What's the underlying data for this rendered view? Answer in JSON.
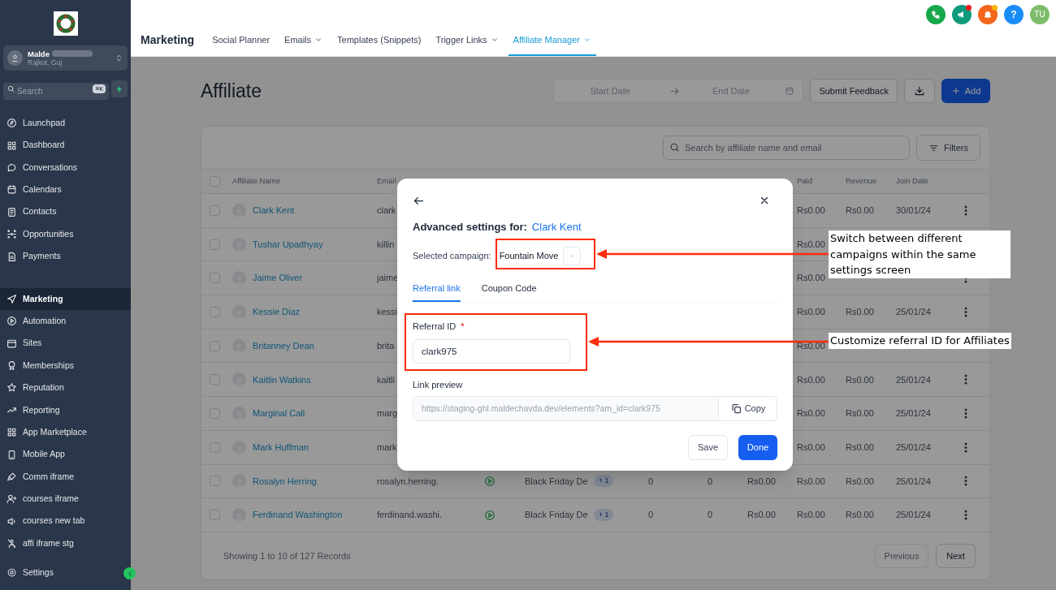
{
  "sidebar": {
    "account": {
      "name": "Malde",
      "location": "Rajkot, Guj"
    },
    "search": {
      "placeholder": "Search",
      "shortcut": "⌘K"
    },
    "groups": [
      {
        "items": [
          {
            "label": "Launchpad",
            "selected": false
          },
          {
            "label": "Dashboard",
            "selected": false
          },
          {
            "label": "Conversations",
            "selected": false
          },
          {
            "label": "Calendars",
            "selected": false
          },
          {
            "label": "Contacts",
            "selected": false
          },
          {
            "label": "Opportunities",
            "selected": false
          },
          {
            "label": "Payments",
            "selected": false
          }
        ]
      },
      {
        "items": [
          {
            "label": "Marketing",
            "selected": true
          },
          {
            "label": "Automation",
            "selected": false
          },
          {
            "label": "Sites",
            "selected": false
          },
          {
            "label": "Memberships",
            "selected": false
          },
          {
            "label": "Reputation",
            "selected": false
          },
          {
            "label": "Reporting",
            "selected": false
          },
          {
            "label": "App Marketplace",
            "selected": false
          },
          {
            "label": "Mobile App",
            "selected": false
          },
          {
            "label": "Comm iframe",
            "selected": false
          },
          {
            "label": "courses iframe",
            "selected": false
          },
          {
            "label": "courses new tab",
            "selected": false
          },
          {
            "label": "affi iframe stg",
            "selected": false
          }
        ]
      }
    ],
    "footer_item": {
      "label": "Settings"
    }
  },
  "header": {
    "section": "Marketing",
    "tabs": [
      {
        "label": "Social Planner",
        "dropdown": false,
        "selected": false
      },
      {
        "label": "Emails",
        "dropdown": true,
        "selected": false
      },
      {
        "label": "Templates (Snippets)",
        "dropdown": false,
        "selected": false
      },
      {
        "label": "Trigger Links",
        "dropdown": true,
        "selected": false
      },
      {
        "label": "Affiliate Manager",
        "dropdown": true,
        "selected": true
      }
    ],
    "actions": [
      {
        "badge": false
      },
      {
        "badge": true,
        "color": "#ef1b1b"
      },
      {
        "badge": true,
        "color": "#f5b400"
      },
      {
        "badge": false,
        "label": "?"
      }
    ],
    "avatar": "TU"
  },
  "page": {
    "title": "Affiliate",
    "start_date_placeholder": "Start Date",
    "end_date_placeholder": "End Date",
    "feedback_button": "Submit Feedback",
    "add_button": "Add"
  },
  "table": {
    "search_placeholder": "Search by affiliate name and email",
    "filters_button": "Filters",
    "select_all_checked": false,
    "columns": {
      "name": "Affiliate Name",
      "email": "Email",
      "paid": "Paid",
      "revenue": "Revenue",
      "join_date": "Join Date"
    },
    "rows": [
      {
        "checked": false,
        "name": "Clark Kent",
        "email": "clark",
        "paid": "Rs0.00",
        "revenue": "Rs0.00",
        "join_date": "30/01/24",
        "menu": true
      },
      {
        "checked": false,
        "name": "Tushar Upadhyay",
        "email": "killin",
        "paid": "Rs0.00"
      },
      {
        "checked": false,
        "name": "Jaime Oliver",
        "email": "jaime",
        "paid": "Rs0.00",
        "menu": true
      },
      {
        "checked": false,
        "name": "Kessie Diaz",
        "email": "kessi",
        "paid": "Rs0.00",
        "revenue": "Rs0.00",
        "join_date": "25/01/24",
        "menu": true
      },
      {
        "checked": false,
        "name": "Britanney Dean",
        "email": "brita",
        "paid": "Rs0.00"
      },
      {
        "checked": false,
        "name": "Kaitlin Watkins",
        "email": "kaitli",
        "paid": "Rs0.00",
        "revenue": "Rs0.00",
        "join_date": "25/01/24",
        "menu": true
      },
      {
        "checked": false,
        "name": "Marginal Call",
        "email": "marg",
        "paid": "Rs0.00",
        "revenue": "Rs0.00",
        "join_date": "25/01/24",
        "menu": true
      },
      {
        "checked": false,
        "name": "Mark Huffman",
        "email": "mark",
        "paid": "Rs0.00",
        "revenue": "Rs0.00",
        "join_date": "25/01/24",
        "menu": true
      },
      {
        "checked": false,
        "name": "Rosalyn Herring",
        "email": "rosalyn.herring.",
        "active": true,
        "campaign": "Black Friday De",
        "campaign_more": "+ 1",
        "column_5": "0",
        "column_6": "0",
        "column_7": "Rs0.00",
        "paid": "Rs0.00",
        "revenue": "Rs0.00",
        "join_date": "25/01/24",
        "menu": true
      },
      {
        "checked": false,
        "name": "Ferdinand Washington",
        "email": "ferdinand.washi.",
        "active": true,
        "campaign": "Black Friday De",
        "campaign_more": "+ 1",
        "column_5": "0",
        "column_6": "0",
        "column_7": "Rs0.00",
        "paid": "Rs0.00",
        "revenue": "Rs0.00",
        "join_date": "25/01/24",
        "menu": true
      }
    ],
    "footer": "Showing 1 to 10 of 127 Records",
    "previous_button": "Previous",
    "next_button": "Next"
  },
  "modal": {
    "heading": "Advanced settings for:",
    "affiliate": "Clark Kent",
    "campaign_label": "Selected campaign:",
    "campaign": "Fountain Move",
    "tabs": [
      {
        "label": "Referral link",
        "selected": true
      },
      {
        "label": "Coupon Code",
        "selected": false
      }
    ],
    "referral_label": "Referral ID",
    "required_mark": "*",
    "referral_id": "clark975",
    "preview_label": "Link preview",
    "preview_url": "https://staging-ghl.maldechavda.dev/elements?am_id=clark975",
    "copy_button": "Copy",
    "save_button": "Save",
    "done_button": "Done"
  },
  "annotations": [
    {
      "text": "Switch between different campaigns within the same settings screen"
    },
    {
      "text": "Customize referral ID for Affiliates"
    }
  ]
}
